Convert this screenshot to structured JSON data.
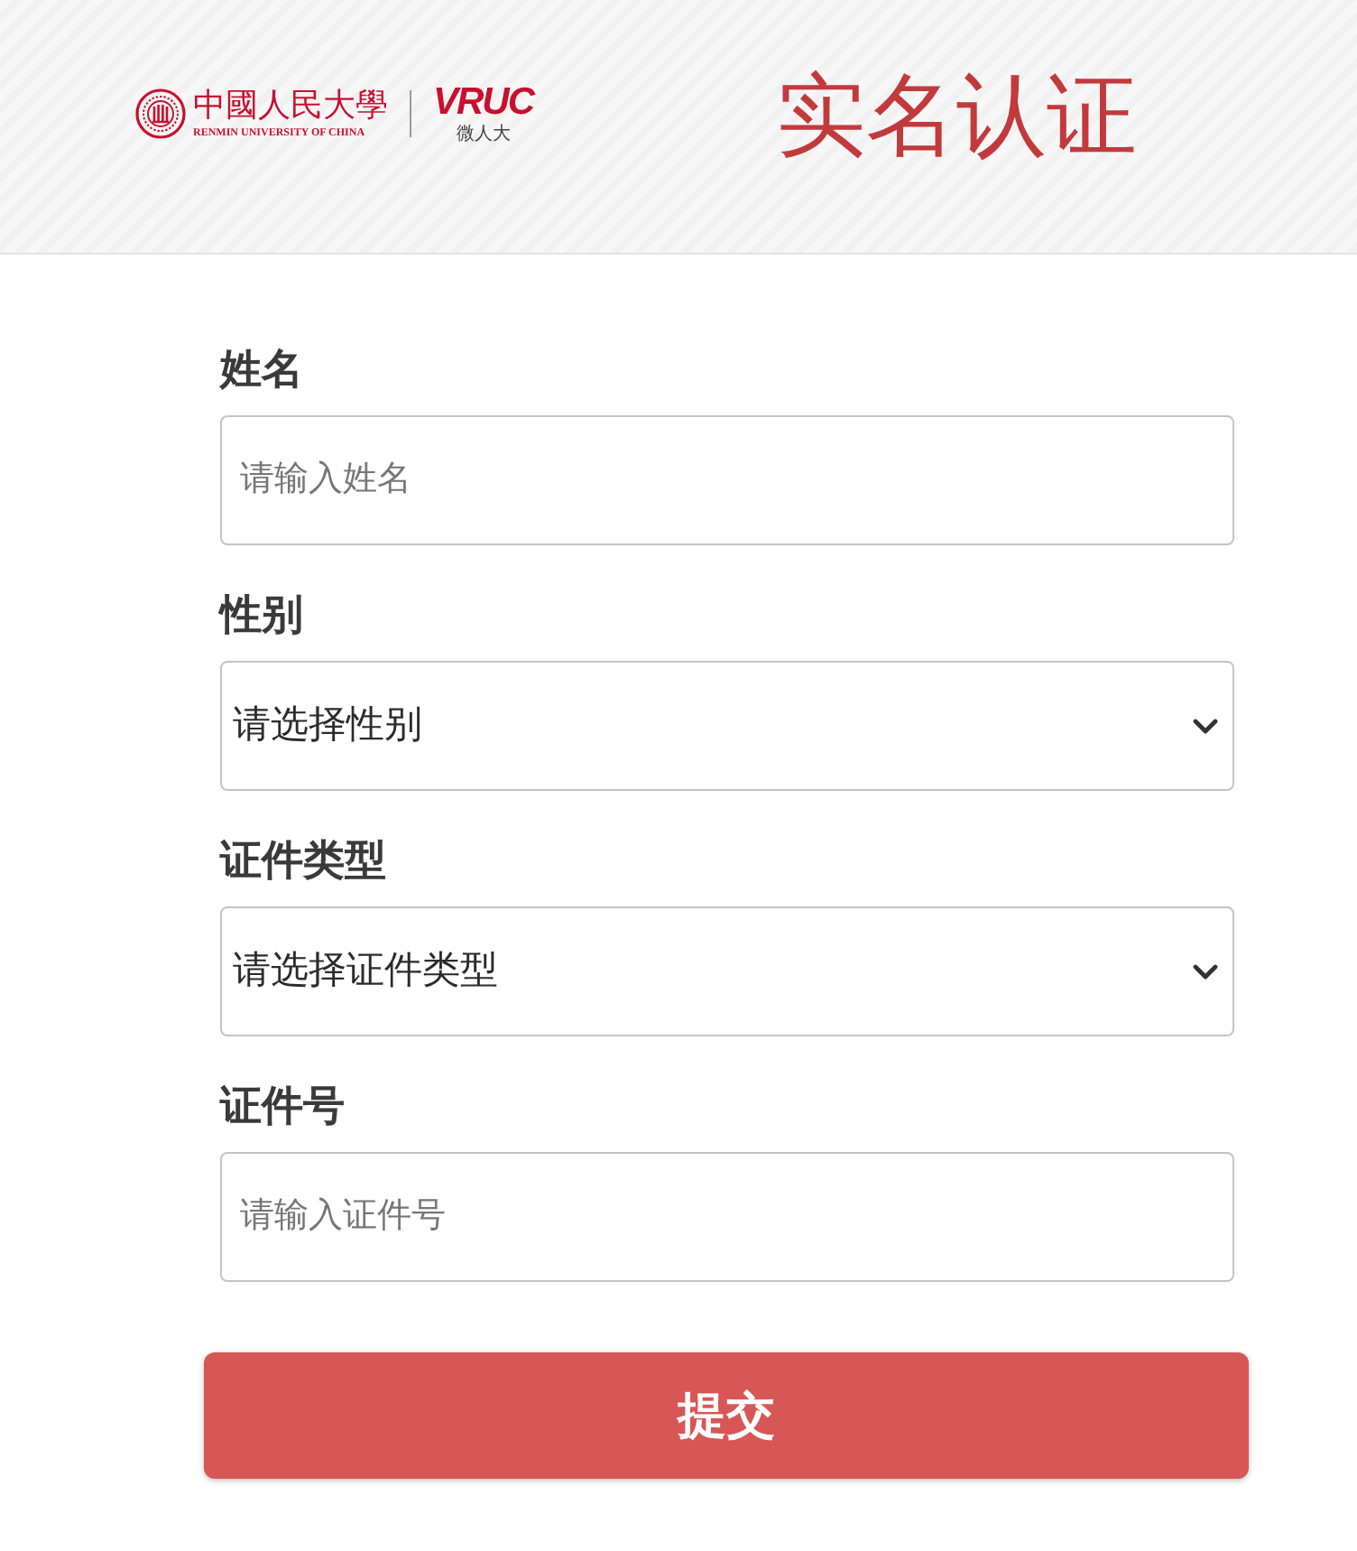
{
  "header": {
    "logo": {
      "name_cn": "中國人民大學",
      "name_en": "RENMIN UNIVERSITY OF CHINA",
      "brand": "VRUC",
      "brand_cn": "微人大"
    },
    "title": "实名认证"
  },
  "form": {
    "fields": [
      {
        "kind": "input",
        "label": "姓名",
        "placeholder": "请输入姓名"
      },
      {
        "kind": "select",
        "label": "性别",
        "value": "请选择性别"
      },
      {
        "kind": "select",
        "label": "证件类型",
        "value": "请选择证件类型"
      },
      {
        "kind": "input",
        "label": "证件号",
        "placeholder": "请输入证件号"
      }
    ],
    "submit": "提交"
  }
}
